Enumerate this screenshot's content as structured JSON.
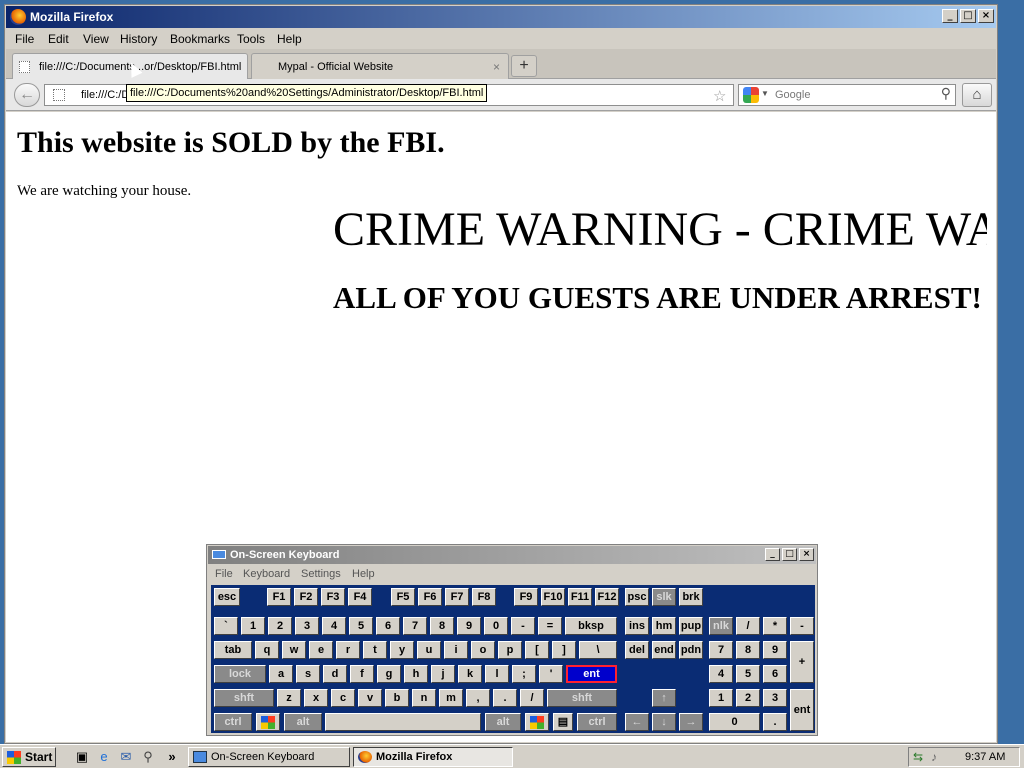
{
  "firefox": {
    "title": "Mozilla Firefox",
    "menu": [
      "File",
      "Edit",
      "View",
      "History",
      "Bookmarks",
      "Tools",
      "Help"
    ],
    "tabs": [
      {
        "label": "file:///C:/Documents...or/Desktop/FBI.html",
        "active": true
      },
      {
        "label": "Mypal - Official Website",
        "active": false
      }
    ],
    "new_tab_symbol": "+",
    "url_value": "file:///C:/Do",
    "url_tooltip": "file:///C:/Documents%20and%20Settings/Administrator/Desktop/FBI.html",
    "search_placeholder": "Google"
  },
  "page": {
    "heading": "This website is SOLD by the FBI.",
    "paragraph": "We are watching your house.",
    "marquee1": "CRIME WARNING - CRIME WARNING - CRIME WARNING",
    "marquee2": "ALL OF YOU GUESTS ARE UNDER ARREST!"
  },
  "osk": {
    "title": "On-Screen Keyboard",
    "menu": [
      "File",
      "Keyboard",
      "Settings",
      "Help"
    ],
    "keys": {
      "esc": "esc",
      "f1": "F1",
      "f2": "F2",
      "f3": "F3",
      "f4": "F4",
      "f5": "F5",
      "f6": "F6",
      "f7": "F7",
      "f8": "F8",
      "f9": "F9",
      "f10": "F10",
      "f11": "F11",
      "f12": "F12",
      "psc": "psc",
      "slk": "slk",
      "brk": "brk",
      "grave": "`",
      "n1": "1",
      "n2": "2",
      "n3": "3",
      "n4": "4",
      "n5": "5",
      "n6": "6",
      "n7": "7",
      "n8": "8",
      "n9": "9",
      "n0": "0",
      "minus": "-",
      "equal": "=",
      "bksp": "bksp",
      "ins": "ins",
      "hm": "hm",
      "pup": "pup",
      "nlk": "nlk",
      "npdiv": "/",
      "npmul": "*",
      "npsub": "-",
      "tab": "tab",
      "q": "q",
      "w": "w",
      "e": "e",
      "r": "r",
      "t": "t",
      "y": "y",
      "u": "u",
      "i": "i",
      "o": "o",
      "p": "p",
      "lbr": "[",
      "rbr": "]",
      "bsl": "\\",
      "del": "del",
      "end": "end",
      "pdn": "pdn",
      "np7": "7",
      "np8": "8",
      "np9": "9",
      "npadd": "+",
      "lock": "lock",
      "a": "a",
      "s": "s",
      "d": "d",
      "f": "f",
      "g": "g",
      "h": "h",
      "j": "j",
      "k": "k",
      "l": "l",
      "semi": ";",
      "quote": "'",
      "ent": "ent",
      "np4": "4",
      "np5": "5",
      "np6": "6",
      "lshft": "shft",
      "z": "z",
      "x": "x",
      "c": "c",
      "v": "v",
      "b": "b",
      "n": "n",
      "m": "m",
      "comma": ",",
      "period": ".",
      "slash": "/",
      "rshft": "shft",
      "up": "↑",
      "np1": "1",
      "np2": "2",
      "np3": "3",
      "npent": "ent",
      "lctrl": "ctrl",
      "lalt": "alt",
      "ralt": "alt",
      "rctrl": "ctrl",
      "left": "←",
      "down": "↓",
      "right": "→",
      "np0": "0",
      "npdot": "."
    }
  },
  "taskbar": {
    "start": "Start",
    "more": "»",
    "items": [
      {
        "label": "On-Screen Keyboard"
      },
      {
        "label": "Mozilla Firefox"
      }
    ],
    "clock": "9:37 AM"
  }
}
